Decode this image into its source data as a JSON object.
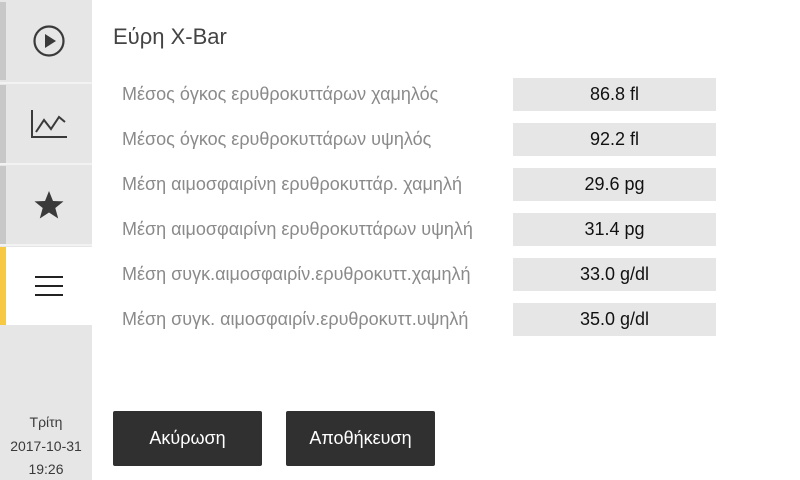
{
  "sidebar": {
    "items": [
      {
        "name": "play-icon"
      },
      {
        "name": "chart-icon"
      },
      {
        "name": "star-icon"
      },
      {
        "name": "menu-icon"
      }
    ],
    "day": "Τρίτη",
    "date": "2017-10-31",
    "time": "19:26",
    "accent_color": "#f6c843"
  },
  "main": {
    "title": "Εύρη X-Bar",
    "rows": [
      {
        "label": "Μέσος όγκος ερυθροκυττάρων χαμηλός",
        "value": "86.8 fl"
      },
      {
        "label": "Μέσος όγκος ερυθροκυττάρων υψηλός",
        "value": "92.2 fl"
      },
      {
        "label": "Μέση αιμοσφαιρίνη ερυθροκυττάρ. χαμηλή",
        "value": "29.6 pg"
      },
      {
        "label": "Μέση αιμοσφαιρίνη ερυθροκυττάρων υψηλή",
        "value": "31.4 pg"
      },
      {
        "label": "Μέση συγκ.αιμοσφαιρίν.ερυθροκυττ.χαμηλή",
        "value": "33.0 g/dl"
      },
      {
        "label": "Μέση συγκ. αιμοσφαιρίν.ερυθροκυττ.υψηλή",
        "value": "35.0 g/dl"
      }
    ],
    "cancel_label": "Ακύρωση",
    "save_label": "Αποθήκευση"
  }
}
